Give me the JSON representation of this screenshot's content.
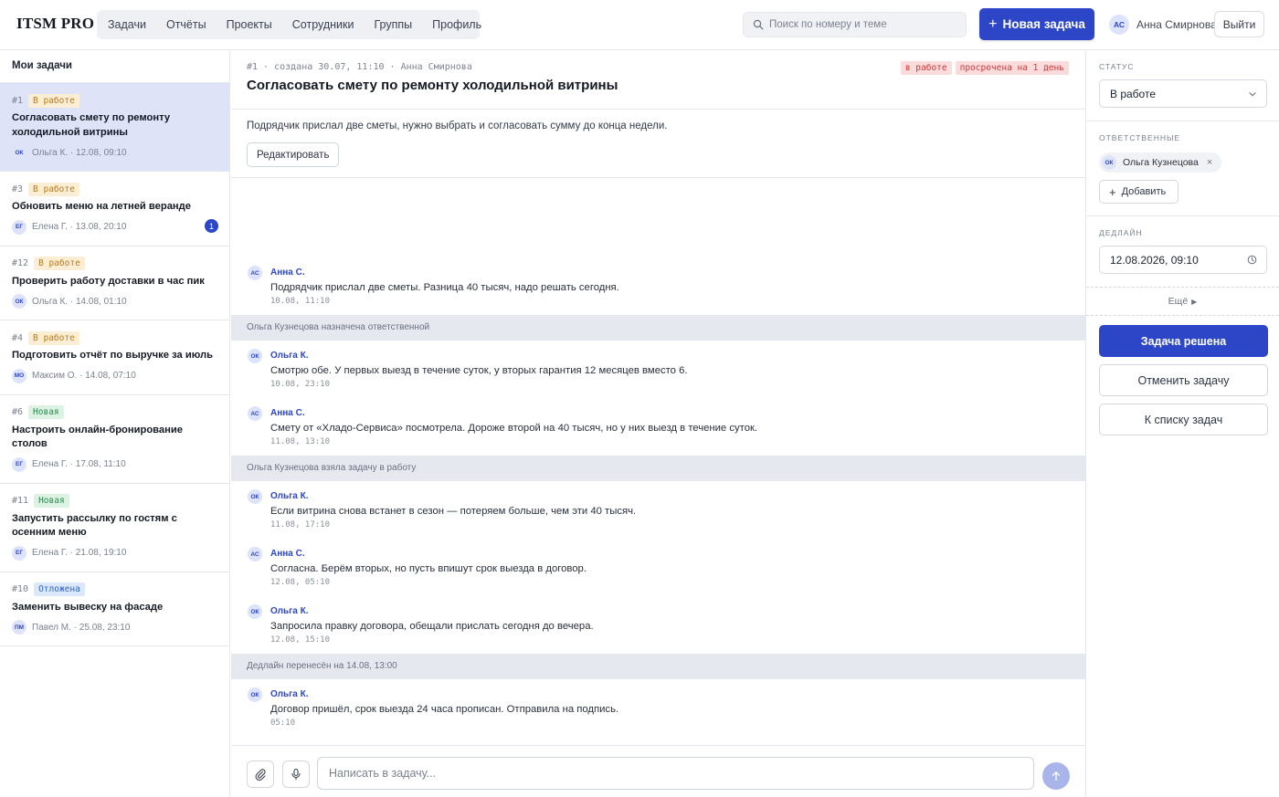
{
  "app": {
    "logo": "ITSM PRO"
  },
  "nav": [
    {
      "label": "Задачи"
    },
    {
      "label": "Отчёты"
    },
    {
      "label": "Проекты"
    },
    {
      "label": "Сотрудники"
    },
    {
      "label": "Группы"
    },
    {
      "label": "Профиль"
    }
  ],
  "search": {
    "placeholder": "Поиск по номеру и теме"
  },
  "header": {
    "new_task": "Новая задача",
    "user_initials": "АС",
    "user_name": "Анна Смирнова",
    "logout": "Выйти"
  },
  "sidebar": {
    "title": "Мои задачи",
    "tasks": [
      {
        "num": "#1",
        "status": "В работе",
        "title": "Согласовать смету по ремонту холодильной витрины",
        "initials": "ОК",
        "person": "Ольга К.",
        "date": "12.08, 09:10"
      },
      {
        "num": "#3",
        "status": "В работе",
        "title": "Обновить меню на летней веранде",
        "initials": "ЕГ",
        "person": "Елена Г.",
        "date": "13.08, 20:10",
        "unread": "1"
      },
      {
        "num": "#12",
        "status": "В работе",
        "title": "Проверить работу доставки в час пик",
        "initials": "ОК",
        "person": "Ольга К.",
        "date": "14.08, 01:10"
      },
      {
        "num": "#4",
        "status": "В работе",
        "title": "Подготовить отчёт по выручке за июль",
        "initials": "МО",
        "person": "Максим О.",
        "date": "14.08, 07:10"
      },
      {
        "num": "#6",
        "status": "Новая",
        "title": "Настроить онлайн-бронирование столов",
        "initials": "ЕГ",
        "person": "Елена Г.",
        "date": "17.08, 11:10"
      },
      {
        "num": "#11",
        "status": "Новая",
        "title": "Запустить рассылку по гостям с осенним меню",
        "initials": "ЕГ",
        "person": "Елена Г.",
        "date": "21.08, 19:10"
      },
      {
        "num": "#10",
        "status": "Отложена",
        "title": "Заменить вывеску на фасаде",
        "initials": "ПМ",
        "person": "Павел М.",
        "date": "25.08, 23:10"
      }
    ]
  },
  "task": {
    "meta": "#1 · создана 30.07, 11:10 · Анна Смирнова",
    "title": "Согласовать смету по ремонту холодильной витрины",
    "badge_status": "в работе",
    "badge_overdue": "просрочена на 1 день",
    "description": "Подрядчик прислал две сметы, нужно выбрать и согласовать сумму до конца недели.",
    "edit": "Редактировать"
  },
  "feed": [
    {
      "type": "msg",
      "initials": "АС",
      "author": "Анна С.",
      "text": "Подрядчик прислал две сметы. Разница 40 тысяч, надо решать сегодня.",
      "time": "10.08, 11:10"
    },
    {
      "type": "sys",
      "text": "Ольга Кузнецова назначена ответственной"
    },
    {
      "type": "msg",
      "initials": "ОК",
      "author": "Ольга К.",
      "text": "Смотрю обе. У первых выезд в течение суток, у вторых гарантия 12 месяцев вместо 6.",
      "time": "10.08, 23:10"
    },
    {
      "type": "msg",
      "initials": "АС",
      "author": "Анна С.",
      "text": "Смету от «Хладо-Сервиса» посмотрела. Дороже второй на 40 тысяч, но у них выезд в течение суток.",
      "time": "11.08, 13:10"
    },
    {
      "type": "sys",
      "text": "Ольга Кузнецова взяла задачу в работу"
    },
    {
      "type": "msg",
      "initials": "ОК",
      "author": "Ольга К.",
      "text": "Если витрина снова встанет в сезон — потеряем больше, чем эти 40 тысяч.",
      "time": "11.08, 17:10"
    },
    {
      "type": "msg",
      "initials": "АС",
      "author": "Анна С.",
      "text": "Согласна. Берём вторых, но пусть впишут срок выезда в договор.",
      "time": "12.08, 05:10"
    },
    {
      "type": "msg",
      "initials": "ОК",
      "author": "Ольга К.",
      "text": "Запросила правку договора, обещали прислать сегодня до вечера.",
      "time": "12.08, 15:10"
    },
    {
      "type": "sys",
      "text": "Дедлайн перенесён на 14.08, 13:00"
    },
    {
      "type": "msg",
      "initials": "ОК",
      "author": "Ольга К.",
      "text": "Договор пришёл, срок выезда 24 часа прописан. Отправила на подпись.",
      "time": "05:10"
    }
  ],
  "composer": {
    "placeholder": "Написать в задачу..."
  },
  "panel": {
    "status_label": "СТАТУС",
    "status_value": "В работе",
    "assignees_label": "ОТВЕТСТВЕННЫЕ",
    "assignee_initials": "ОК",
    "assignee_name": "Ольга Кузнецова",
    "add_label": "Добавить",
    "deadline_label": "ДЕДЛАЙН",
    "deadline_value": "12.08.2026, 09:10",
    "more_label": "Ещё",
    "resolve": "Задача решена",
    "cancel": "Отменить задачу",
    "back": "К списку задач"
  },
  "colors": {
    "accent": "#2d46c8",
    "active_row": "#dee3f7",
    "status_work": "#b97a16",
    "status_new": "#2b8a4d",
    "status_postponed": "#2c63c9",
    "overdue": "#d33636"
  }
}
